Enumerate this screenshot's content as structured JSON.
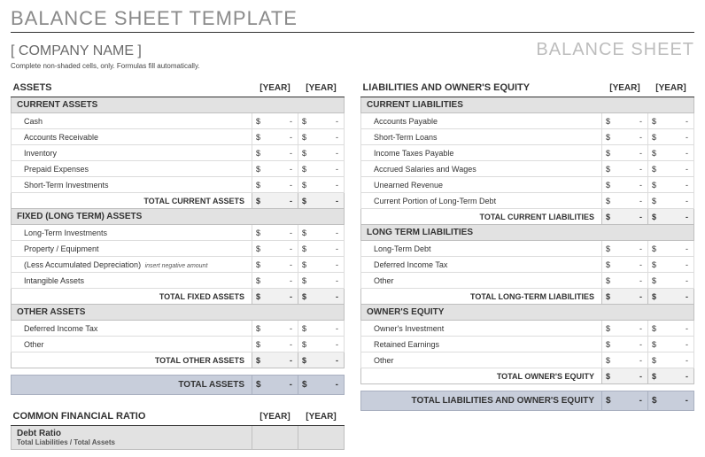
{
  "title": "BALANCE SHEET TEMPLATE",
  "company": "[ COMPANY NAME ]",
  "bs_label": "BALANCE SHEET",
  "instructions": "Complete non-shaded cells, only.  Formulas fill automatically.",
  "year1": "[YEAR]",
  "year2": "[YEAR]",
  "cur": "$",
  "dash": "-",
  "left": {
    "heading": "ASSETS",
    "sections": [
      {
        "title": "CURRENT ASSETS",
        "items": [
          "Cash",
          "Accounts Receivable",
          "Inventory",
          "Prepaid Expenses",
          "Short-Term Investments"
        ],
        "total": "TOTAL CURRENT ASSETS"
      },
      {
        "title": "FIXED (LONG TERM) ASSETS",
        "items": [
          "Long-Term Investments",
          "Property / Equipment",
          "(Less Accumulated Depreciation)",
          "Intangible Assets"
        ],
        "notes": {
          "2": "insert negative amount"
        },
        "total": "TOTAL FIXED ASSETS"
      },
      {
        "title": "OTHER ASSETS",
        "items": [
          "Deferred Income Tax",
          "Other"
        ],
        "total": "TOTAL OTHER ASSETS"
      }
    ],
    "grand": "TOTAL ASSETS"
  },
  "right": {
    "heading": "LIABILITIES AND OWNER'S EQUITY",
    "sections": [
      {
        "title": "CURRENT LIABILITIES",
        "items": [
          "Accounts Payable",
          "Short-Term Loans",
          "Income Taxes Payable",
          "Accrued Salaries and Wages",
          "Unearned Revenue",
          "Current Portion of Long-Term Debt"
        ],
        "total": "TOTAL CURRENT LIABILITIES"
      },
      {
        "title": "LONG TERM LIABILITIES",
        "items": [
          "Long-Term Debt",
          "Deferred Income Tax",
          "Other"
        ],
        "total": "TOTAL LONG-TERM LIABILITIES"
      },
      {
        "title": "OWNER'S EQUITY",
        "items": [
          "Owner's Investment",
          "Retained Earnings",
          "Other"
        ],
        "total": "TOTAL OWNER'S EQUITY"
      }
    ],
    "grand": "TOTAL LIABILITIES AND OWNER'S EQUITY"
  },
  "ratio": {
    "heading": "COMMON FINANCIAL RATIO",
    "item": "Debt Ratio",
    "formula": "Total Liabilities / Total Assets"
  }
}
